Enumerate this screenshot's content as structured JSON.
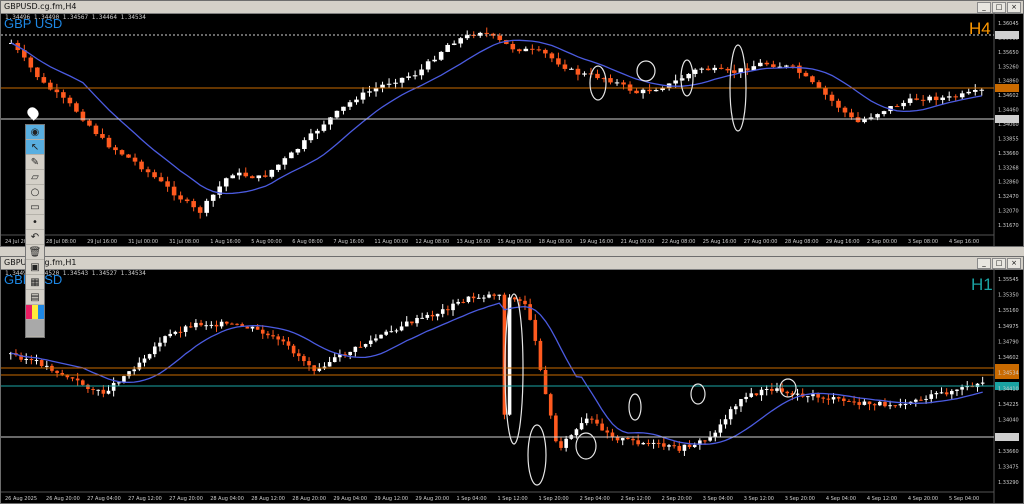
{
  "top": {
    "title": "GBPUSD.cg.fm,H4",
    "ohlc": "1.34496 1.34490 1.34567 1.34464 1.34534",
    "symbol": "GBP USD",
    "timeframe": "H4",
    "tf_color": "#ff9900",
    "price_labels": [
      "1.36045",
      "1.35815",
      "1.35650",
      "1.35260",
      "1.34860",
      "1.34602",
      "1.34460",
      "1.34060",
      "1.33855",
      "1.33660",
      "1.33268",
      "1.32860",
      "1.32470",
      "1.32070",
      "1.31670"
    ],
    "time_labels": [
      "24 Jul 2025",
      "28 Jul 08:00",
      "29 Jul 16:00",
      "31 Jul 00:00",
      "31 Jul 08:00",
      "1 Aug 16:00",
      "5 Aug 00:00",
      "6 Aug 08:00",
      "7 Aug 16:00",
      "11 Aug 00:00",
      "12 Aug 08:00",
      "13 Aug 16:00",
      "15 Aug 00:00",
      "18 Aug 08:00",
      "19 Aug 16:00",
      "21 Aug 00:00",
      "22 Aug 08:00",
      "25 Aug 16:00",
      "27 Aug 00:00",
      "28 Aug 08:00",
      "29 Aug 16:00",
      "2 Sep 00:00",
      "3 Sep 08:00",
      "4 Sep 16:00"
    ]
  },
  "bottom": {
    "title": "GBPUSD.cg.fm,H1",
    "ohlc": "1.34496 1.34520 1.34543 1.34527 1.34534",
    "symbol": "GBP USD",
    "timeframe": "H1",
    "tf_color": "#1aa3a3",
    "price_labels": [
      "1.35545",
      "1.35350",
      "1.35160",
      "1.34975",
      "1.34790",
      "1.34602",
      "1.34534",
      "1.34410",
      "1.34225",
      "1.34040",
      "1.33855",
      "1.33660",
      "1.33475",
      "1.33290"
    ],
    "time_labels": [
      "26 Aug 2025",
      "26 Aug 20:00",
      "27 Aug 04:00",
      "27 Aug 12:00",
      "27 Aug 20:00",
      "28 Aug 04:00",
      "28 Aug 12:00",
      "28 Aug 20:00",
      "29 Aug 04:00",
      "29 Aug 12:00",
      "29 Aug 20:00",
      "1 Sep 04:00",
      "1 Sep 12:00",
      "1 Sep 20:00",
      "2 Sep 04:00",
      "2 Sep 12:00",
      "2 Sep 20:00",
      "3 Sep 04:00",
      "3 Sep 12:00",
      "3 Sep 20:00",
      "4 Sep 04:00",
      "4 Sep 12:00",
      "4 Sep 20:00",
      "5 Sep 04:00"
    ]
  },
  "toolbar": [
    "eye-icon",
    "cursor-icon",
    "brush-icon",
    "highlighter-icon",
    "circle-icon",
    "ruler-icon",
    "dot-icon",
    "undo-icon",
    "trash-icon",
    "stamp-icon",
    "screenshot-icon",
    "clipboard-icon",
    "palette-icon",
    "gray-swatch"
  ],
  "window_buttons": {
    "min": "_",
    "max": "□",
    "close": "×"
  },
  "colors": {
    "bull": "#ffffff",
    "bear": "#ff5a1f",
    "ma": "#4b5be0",
    "orange_line": "#c96a00",
    "white_line": "#cfcfcf",
    "circle": "#e6e6e6"
  },
  "chart_data": [
    {
      "type": "candlestick",
      "timeframe": "H4",
      "moving_average": true,
      "horizontal_levels": [
        1.36045,
        1.34602,
        1.33855
      ],
      "circled_regions": 5
    },
    {
      "type": "candlestick",
      "timeframe": "H1",
      "moving_average": true,
      "horizontal_levels": [
        1.34602,
        1.34534,
        1.33855
      ],
      "circled_regions": 6
    }
  ]
}
